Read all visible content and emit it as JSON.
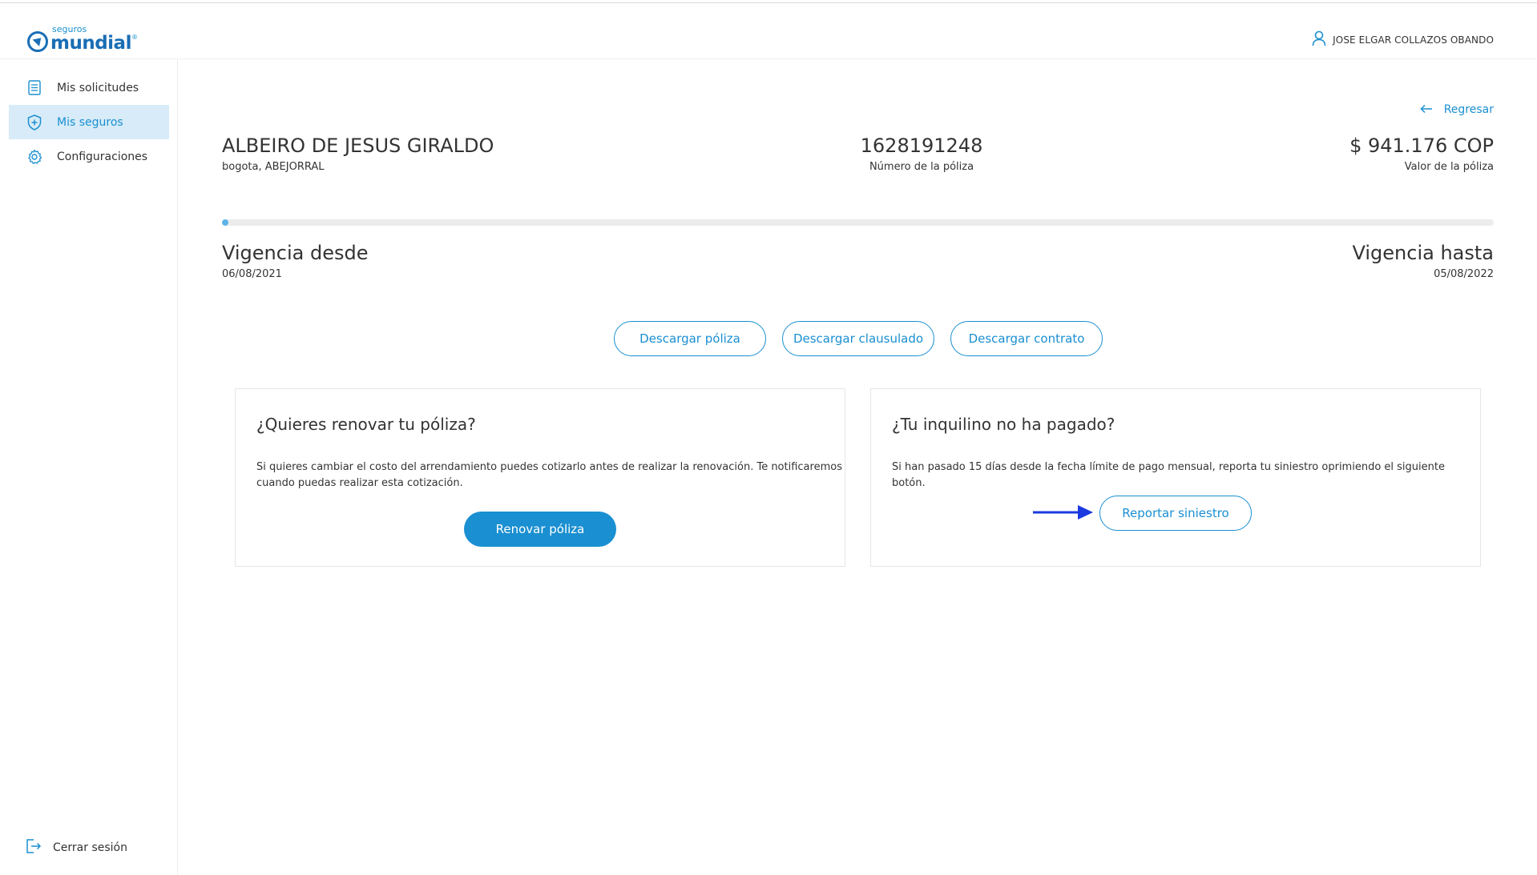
{
  "brand": {
    "small": "seguros",
    "name": "mundial",
    "reg": "®",
    "color": "#1a6eb5"
  },
  "header": {
    "user_name": "JOSE ELGAR COLLAZOS OBANDO",
    "user_icon": "user-icon"
  },
  "sidebar": {
    "items": [
      {
        "label": "Mis solicitudes",
        "icon": "document-list-icon",
        "active": false
      },
      {
        "label": "Mis seguros",
        "icon": "shield-plus-icon",
        "active": true
      },
      {
        "label": "Configuraciones",
        "icon": "gear-icon",
        "active": false
      }
    ],
    "logout_label": "Cerrar sesión"
  },
  "main": {
    "back_label": "Regresar",
    "holder": {
      "name": "ALBEIRO DE JESUS GIRALDO",
      "location": "bogota, ABEJORRAL"
    },
    "policy": {
      "number": "1628191248",
      "number_label": "Número de la póliza",
      "value": "$ 941.176 COP",
      "value_label": "Valor de la póliza"
    },
    "validity": {
      "progress_fraction": 0.005,
      "from_title": "Vigencia desde",
      "from_date": "06/08/2021",
      "to_title": "Vigencia hasta",
      "to_date": "05/08/2022"
    },
    "downloads": {
      "policy": "Descargar póliza",
      "clauses": "Descargar clausulado",
      "contract": "Descargar contrato"
    },
    "renew_card": {
      "title": "¿Quieres renovar tu póliza?",
      "text_line1": "Si quieres cambiar el costo del arrendamiento puedes cotizarlo antes de realizar la renovación. Te notificaremos",
      "text_line2": "cuando puedas realizar esta cotización.",
      "button": "Renovar póliza"
    },
    "claim_card": {
      "title": "¿Tu inquilino no ha pagado?",
      "text": "Si han pasado 15 días desde la fecha límite de pago mensual, reporta tu siniestro oprimiendo el siguiente botón.",
      "button": "Reportar siniestro"
    }
  },
  "colors": {
    "accent": "#1a8fd1",
    "active_bg": "#d7ecf8",
    "progress": "#5ab4e5",
    "annotation_arrow": "#1a3adf"
  }
}
